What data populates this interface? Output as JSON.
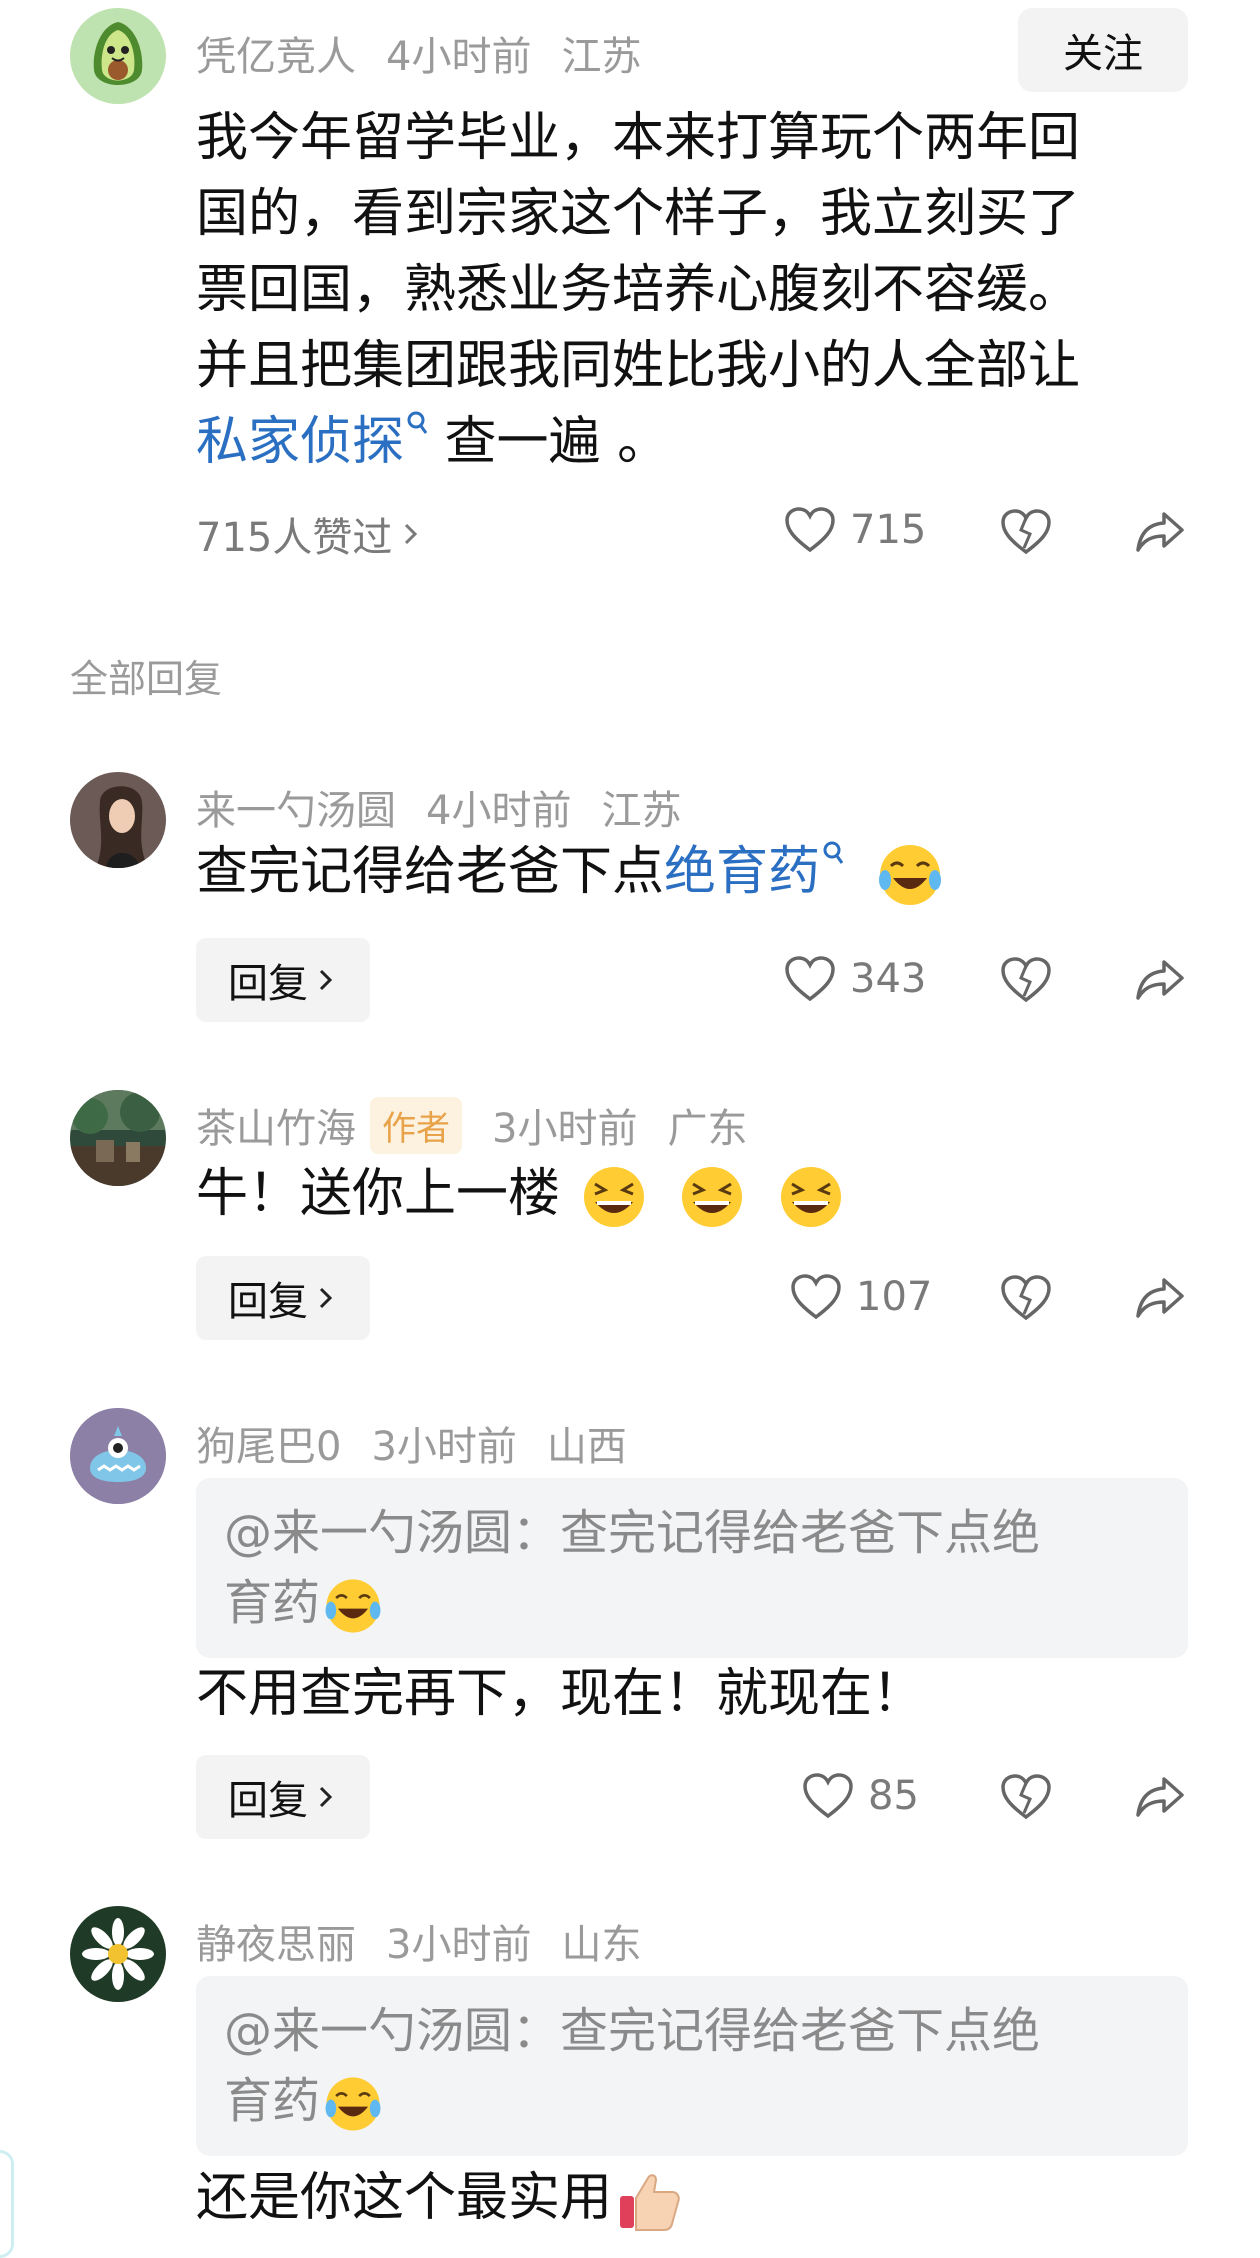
{
  "main_comment": {
    "username": "凭亿竞人",
    "time": "4小时前",
    "location": "江苏",
    "follow_label": "关注",
    "line1": "我今年留学毕业，本来打算玩个两年回",
    "line2": "国的，看到宗家这个样子，我立刻买了",
    "line3": "票回国，熟悉业务培养心腹刻不容缓。",
    "line4": "并且把集团跟我同姓比我小的人全部让",
    "link_text": "私家侦探",
    "line5_tail": " 查一遍 。",
    "likers_label": "715人赞过",
    "like_count": "715",
    "avatar_icon": "avocado-avatar"
  },
  "section_label": "全部回复",
  "replies": [
    {
      "username": "来一勺汤圆",
      "time": "4小时前",
      "location": "江苏",
      "text": "查完记得给老爸下点",
      "link_text": "绝育药",
      "reply_label": "回复",
      "like_count": "343"
    },
    {
      "username": "茶山竹海",
      "author_badge": "作者",
      "time": "3小时前",
      "location": "广东",
      "text": "牛！送你上一楼",
      "reply_label": "回复",
      "like_count": "107"
    },
    {
      "username": "狗尾巴0",
      "time": "3小时前",
      "location": "山西",
      "quote_line1": "@来一勺汤圆：查完记得给老爸下点绝",
      "quote_line2": "育药",
      "text": "不用查完再下，现在！就现在！",
      "reply_label": "回复",
      "like_count": "85"
    },
    {
      "username": "静夜思丽",
      "time": "3小时前",
      "location": "山东",
      "quote_line1": "@来一勺汤圆：查完记得给老爸下点绝",
      "quote_line2": "育药",
      "text": "还是你这个最实用"
    }
  ],
  "colors": {
    "link": "#2a6fc2",
    "meta": "#9a9a9a",
    "author_badge_bg": "#fdf1df",
    "author_badge_fg": "#e8a34a",
    "button_bg": "#f3f3f3"
  }
}
